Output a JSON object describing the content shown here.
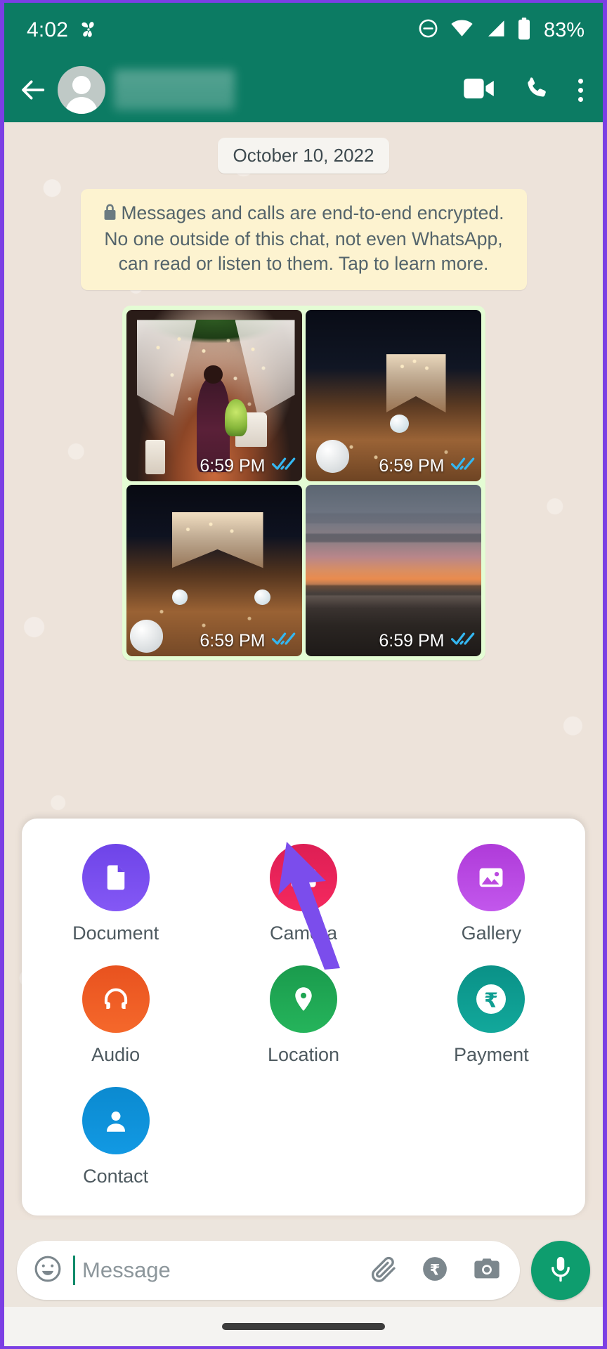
{
  "status_bar": {
    "time": "4:02",
    "battery_percent": "83%",
    "icons": [
      "fan-icon",
      "do-not-disturb-icon",
      "wifi-icon",
      "cellular-signal-icon",
      "battery-icon"
    ]
  },
  "app_bar": {
    "back_icon": "back-arrow-icon",
    "avatar": "contact-avatar",
    "contact_name": "",
    "actions": [
      "video-call-icon",
      "voice-call-icon",
      "overflow-menu-icon"
    ]
  },
  "chat": {
    "date_divider": "October 10, 2022",
    "encryption_notice": "Messages and calls are end-to-end encrypted. No one outside of this chat, not even WhatsApp, can read or listen to them. Tap to learn more.",
    "encryption_lock_icon": "lock-icon",
    "album": {
      "photos": [
        {
          "alt": "woman-in-lit-tent",
          "time": "6:59 PM",
          "status": "read"
        },
        {
          "alt": "beach-tent-at-night",
          "time": "6:59 PM",
          "status": "read"
        },
        {
          "alt": "decorated-tent-on-sand",
          "time": "6:59 PM",
          "status": "read"
        },
        {
          "alt": "sunset-over-sea",
          "time": "6:59 PM",
          "status": "read"
        }
      ],
      "read_tick_color": "#34B7F1"
    }
  },
  "attachment_panel": {
    "items": [
      {
        "label": "Document",
        "icon": "document-icon",
        "color": "#7B4DEC"
      },
      {
        "label": "Camera",
        "icon": "camera-icon",
        "color": "#EC2556"
      },
      {
        "label": "Gallery",
        "icon": "gallery-icon",
        "color": "#BB49E0"
      },
      {
        "label": "Audio",
        "icon": "headphones-icon",
        "color": "#F05A22"
      },
      {
        "label": "Location",
        "icon": "location-pin-icon",
        "color": "#1FA552"
      },
      {
        "label": "Payment",
        "icon": "rupee-icon",
        "color": "#0F9E92"
      },
      {
        "label": "Contact",
        "icon": "contact-icon",
        "color": "#0E94DB"
      }
    ]
  },
  "annotation": {
    "arrow_color": "#7B4DEC",
    "points_to": "Camera"
  },
  "input_bar": {
    "emoji_icon": "emoji-icon",
    "placeholder": "Message",
    "value": "",
    "icons": [
      "attach-paperclip-icon",
      "payment-rupee-icon",
      "camera-icon"
    ],
    "mic_icon": "microphone-icon",
    "mic_color": "#0E9D6E"
  },
  "nav_bar": {
    "gesture_pill": "home-gesture-pill"
  }
}
